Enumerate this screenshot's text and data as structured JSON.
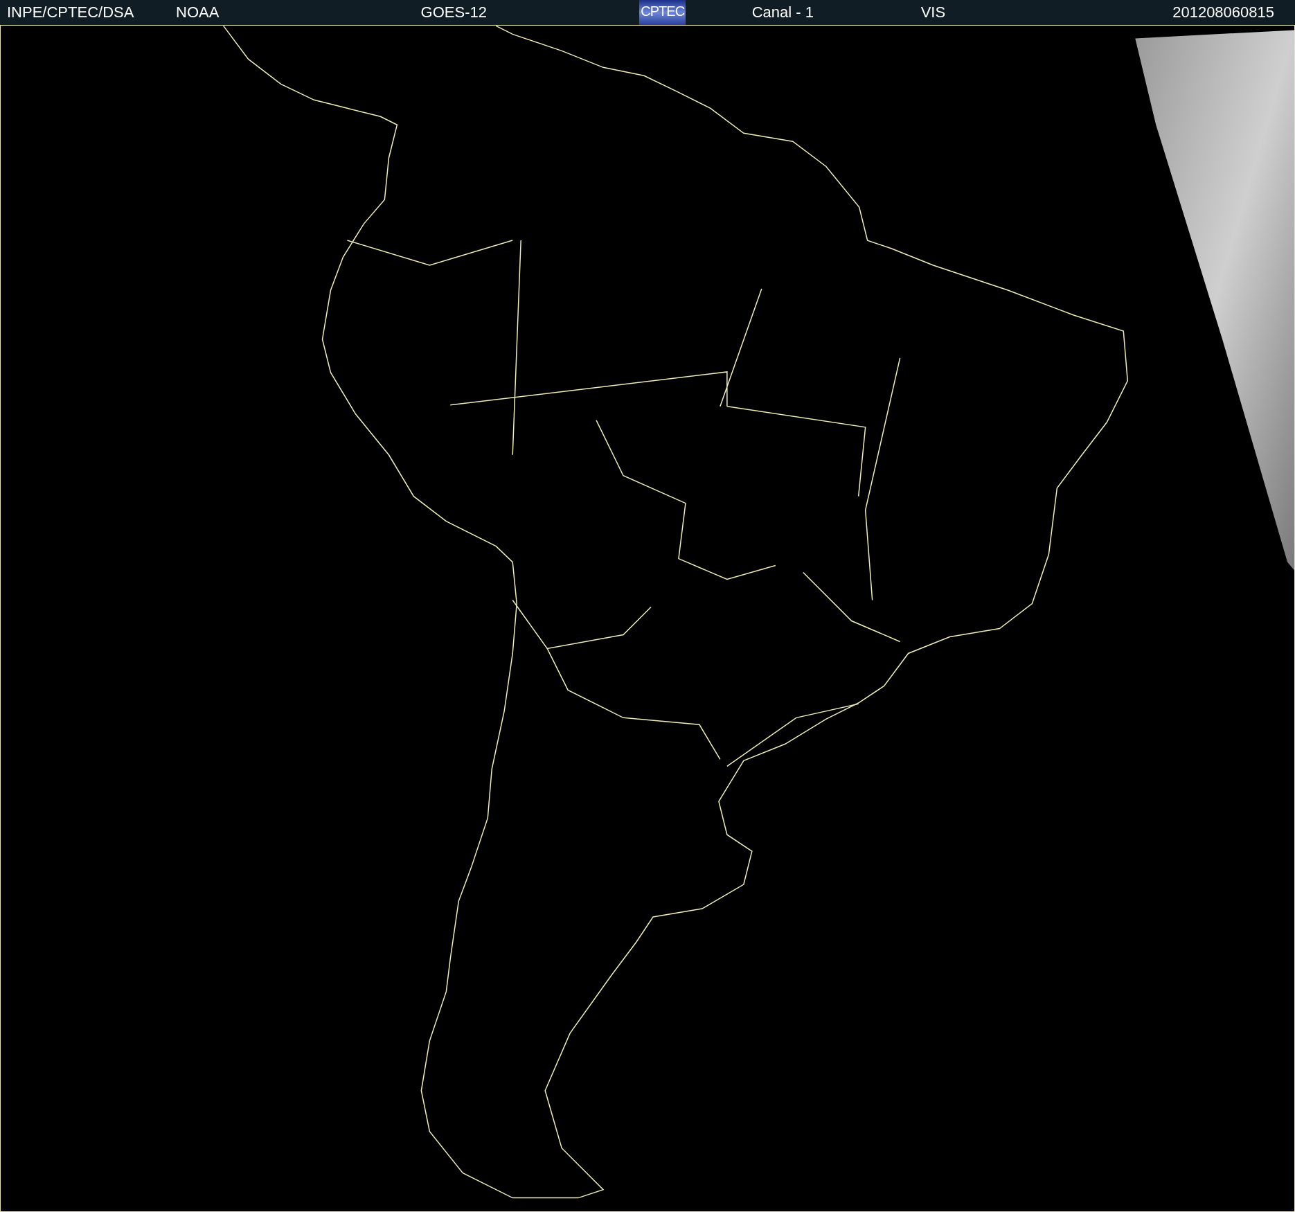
{
  "header": {
    "items": [
      {
        "kind": "text",
        "text": "INPE/CPTEC/DSA"
      },
      {
        "kind": "text",
        "text": "NOAA"
      },
      {
        "kind": "text",
        "text": "GOES-12"
      },
      {
        "kind": "logo",
        "text": "CPTEC"
      },
      {
        "kind": "text",
        "text": "Canal - 1"
      },
      {
        "kind": "text",
        "text": "VIS"
      },
      {
        "kind": "text",
        "text": "201208060815"
      }
    ]
  }
}
